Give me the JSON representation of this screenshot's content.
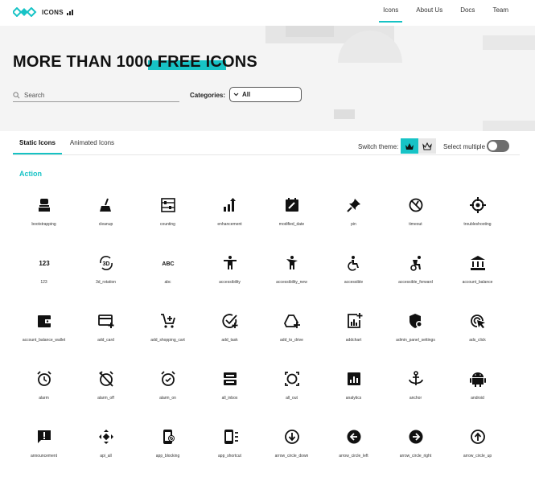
{
  "brand": {
    "name": "ICONS",
    "accent": "#17c3c6"
  },
  "nav": {
    "items": [
      "Icons",
      "About Us",
      "Docs",
      "Team"
    ],
    "active": 0
  },
  "hero": {
    "title": "MORE THAN 1000 FREE ICONS"
  },
  "search": {
    "placeholder": "Search",
    "value": ""
  },
  "categories": {
    "label": "Categories:",
    "value": "All"
  },
  "tabs": {
    "items": [
      "Static Icons",
      "Animated Icons"
    ],
    "active": 0
  },
  "theme": {
    "label": "Switch theme:",
    "options": [
      "crown-filled-icon",
      "crown-outline-icon"
    ],
    "selected": 0
  },
  "select_multiple": {
    "label": "Select multiple",
    "on": false
  },
  "section": {
    "title": "Action"
  },
  "icons": [
    {
      "name": "bootstrapping",
      "icon": "bootstrapping-icon"
    },
    {
      "name": "cleanup",
      "icon": "cleanup-icon"
    },
    {
      "name": "counting",
      "icon": "counting-icon"
    },
    {
      "name": "enhancement",
      "icon": "enhancement-icon"
    },
    {
      "name": "modified_date",
      "icon": "modified-date-icon"
    },
    {
      "name": "pin",
      "icon": "pin-icon"
    },
    {
      "name": "timeout",
      "icon": "timeout-icon"
    },
    {
      "name": "troubleshooting",
      "icon": "troubleshooting-icon"
    },
    {
      "name": "123",
      "icon": "123-icon"
    },
    {
      "name": "3d_rotation",
      "icon": "3d-rotation-icon"
    },
    {
      "name": "abc",
      "icon": "abc-icon"
    },
    {
      "name": "accessibility",
      "icon": "accessibility-icon"
    },
    {
      "name": "accessibility_new",
      "icon": "accessibility-new-icon"
    },
    {
      "name": "accessible",
      "icon": "accessible-icon"
    },
    {
      "name": "accessible_forward",
      "icon": "accessible-forward-icon"
    },
    {
      "name": "account_balance",
      "icon": "account-balance-icon"
    },
    {
      "name": "account_balance_wallet",
      "icon": "wallet-icon"
    },
    {
      "name": "add_card",
      "icon": "add-card-icon"
    },
    {
      "name": "add_shopping_cart",
      "icon": "add-shopping-cart-icon"
    },
    {
      "name": "add_task",
      "icon": "add-task-icon"
    },
    {
      "name": "add_to_drive",
      "icon": "add-to-drive-icon"
    },
    {
      "name": "addchart",
      "icon": "addchart-icon"
    },
    {
      "name": "admin_panel_settings",
      "icon": "admin-panel-settings-icon"
    },
    {
      "name": "ads_click",
      "icon": "ads-click-icon"
    },
    {
      "name": "alarm",
      "icon": "alarm-icon"
    },
    {
      "name": "alarm_off",
      "icon": "alarm-off-icon"
    },
    {
      "name": "alarm_on",
      "icon": "alarm-on-icon"
    },
    {
      "name": "all_inbox",
      "icon": "all-inbox-icon"
    },
    {
      "name": "all_out",
      "icon": "all-out-icon"
    },
    {
      "name": "analytics",
      "icon": "analytics-icon"
    },
    {
      "name": "anchor",
      "icon": "anchor-icon"
    },
    {
      "name": "android",
      "icon": "android-icon"
    },
    {
      "name": "announcement",
      "icon": "announcement-icon"
    },
    {
      "name": "api_all",
      "icon": "api-all-icon"
    },
    {
      "name": "app_blocking",
      "icon": "app-blocking-icon"
    },
    {
      "name": "app_shortcut",
      "icon": "app-shortcut-icon"
    },
    {
      "name": "arrow_circle_down",
      "icon": "arrow-circle-down-icon"
    },
    {
      "name": "arrow_circle_left",
      "icon": "arrow-circle-left-icon"
    },
    {
      "name": "arrow_circle_right",
      "icon": "arrow-circle-right-icon"
    },
    {
      "name": "arrow_circle_up",
      "icon": "arrow-circle-up-icon"
    }
  ]
}
